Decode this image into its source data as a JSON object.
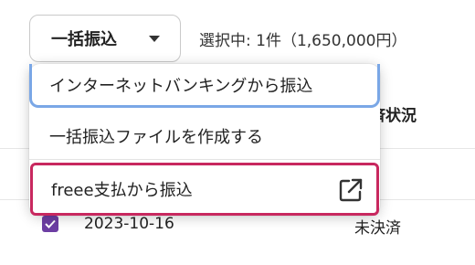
{
  "toolbar": {
    "bulk_transfer_label": "一括振込",
    "selection_text": "選択中: 1件（1,650,000円）"
  },
  "table": {
    "status_header": "決済状況",
    "rows": [
      {
        "date": "2023-10-16",
        "status": "未決済",
        "checked": true
      }
    ]
  },
  "dropdown": {
    "items": [
      {
        "label": "インターネットバンキングから振込"
      },
      {
        "label": "一括振込ファイルを作成する"
      },
      {
        "label": "freee支払から振込",
        "icon": "external-link-icon"
      }
    ]
  },
  "colors": {
    "focus_ring": "#7aa7e6",
    "highlight_border": "#c8285f",
    "checkbox": "#6d3ea3"
  }
}
